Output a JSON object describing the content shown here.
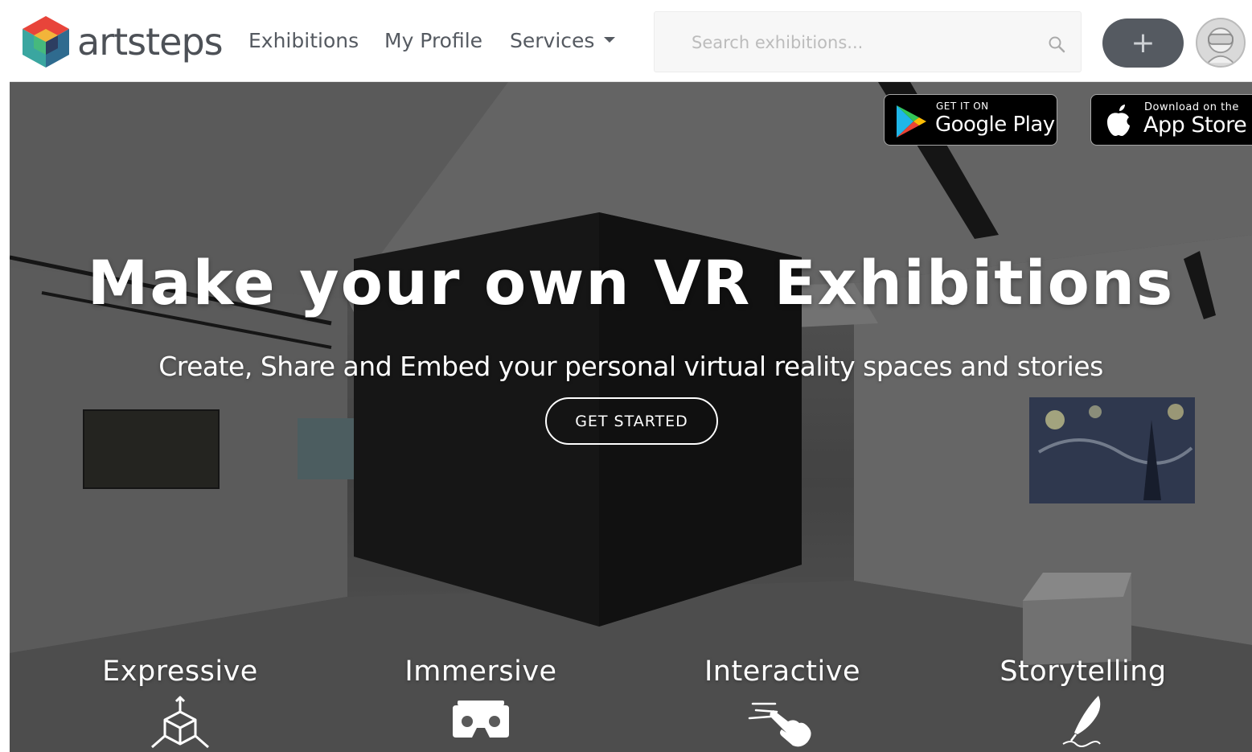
{
  "brand": {
    "name": "artsteps"
  },
  "nav": {
    "exhibitions": "Exhibitions",
    "profile": "My Profile",
    "services": "Services"
  },
  "search": {
    "placeholder": "Search exhibitions..."
  },
  "toolbar": {
    "add_label": "+"
  },
  "badges": {
    "google": {
      "small": "GET IT ON",
      "big": "Google Play"
    },
    "apple": {
      "small": "Download on the",
      "big": "App Store"
    }
  },
  "hero": {
    "title": "Make your own VR Exhibitions",
    "subtitle": "Create, Share and Embed your personal virtual reality spaces and stories",
    "cta": "GET STARTED"
  },
  "features": [
    {
      "label": "Expressive",
      "icon": "cube-icon"
    },
    {
      "label": "Immersive",
      "icon": "vr-headset-icon"
    },
    {
      "label": "Interactive",
      "icon": "pointer-hand-icon"
    },
    {
      "label": "Storytelling",
      "icon": "quill-icon"
    }
  ],
  "colors": {
    "nav_text": "#555a61",
    "add_button": "#555a61",
    "hero_text": "#ffffff"
  }
}
